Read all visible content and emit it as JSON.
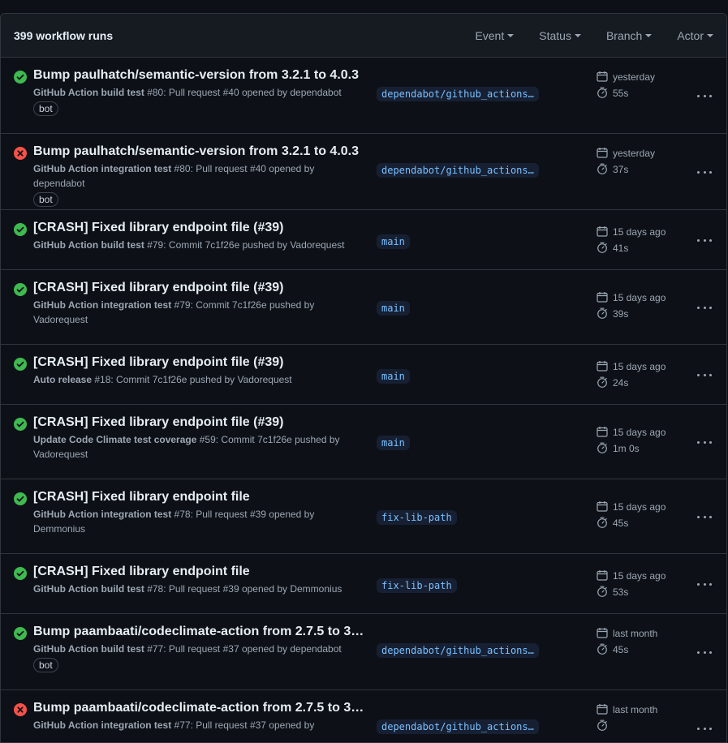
{
  "header": {
    "runs_count": "399 workflow runs",
    "filters": [
      {
        "label": "Event"
      },
      {
        "label": "Status"
      },
      {
        "label": "Branch"
      },
      {
        "label": "Actor"
      }
    ]
  },
  "runs": [
    {
      "status": "success",
      "title": "Bump paulhatch/semantic-version from 3.2.1 to 4.0.3",
      "workflow": "GitHub Action build test",
      "detail": " #80: Pull request #40 opened by dependabot",
      "bot": "bot",
      "branch": "dependabot/github_actions…",
      "when": "yesterday",
      "duration": "55s"
    },
    {
      "status": "failure",
      "title": "Bump paulhatch/semantic-version from 3.2.1 to 4.0.3",
      "workflow": "GitHub Action integration test",
      "detail": " #80: Pull request #40 opened by dependabot",
      "bot": "bot",
      "branch": "dependabot/github_actions…",
      "when": "yesterday",
      "duration": "37s"
    },
    {
      "status": "success",
      "title": "[CRASH] Fixed library endpoint file (#39)",
      "workflow": "GitHub Action build test",
      "detail": " #79: Commit 7c1f26e pushed by Vadorequest",
      "bot": "",
      "branch": "main",
      "when": "15 days ago",
      "duration": "41s"
    },
    {
      "status": "success",
      "title": "[CRASH] Fixed library endpoint file (#39)",
      "workflow": "GitHub Action integration test",
      "detail": " #79: Commit 7c1f26e pushed by Vadorequest",
      "bot": "",
      "branch": "main",
      "when": "15 days ago",
      "duration": "39s"
    },
    {
      "status": "success",
      "title": "[CRASH] Fixed library endpoint file (#39)",
      "workflow": "Auto release",
      "detail": " #18: Commit 7c1f26e pushed by Vadorequest",
      "bot": "",
      "branch": "main",
      "when": "15 days ago",
      "duration": "24s"
    },
    {
      "status": "success",
      "title": "[CRASH] Fixed library endpoint file (#39)",
      "workflow": "Update Code Climate test coverage",
      "detail": " #59: Commit 7c1f26e pushed by Vadorequest",
      "bot": "",
      "branch": "main",
      "when": "15 days ago",
      "duration": "1m 0s"
    },
    {
      "status": "success",
      "title": "[CRASH] Fixed library endpoint file",
      "workflow": "GitHub Action integration test",
      "detail": " #78: Pull request #39 opened by Demmonius",
      "bot": "",
      "branch": "fix-lib-path",
      "when": "15 days ago",
      "duration": "45s"
    },
    {
      "status": "success",
      "title": "[CRASH] Fixed library endpoint file",
      "workflow": "GitHub Action build test",
      "detail": " #78: Pull request #39 opened by Demmonius",
      "bot": "",
      "branch": "fix-lib-path",
      "when": "15 days ago",
      "duration": "53s"
    },
    {
      "status": "success",
      "title": "Bump paambaati/codeclimate-action from 2.7.5 to 3…",
      "workflow": "GitHub Action build test",
      "detail": " #77: Pull request #37 opened by dependabot",
      "bot": "bot",
      "branch": "dependabot/github_actions…",
      "when": "last month",
      "duration": "45s"
    },
    {
      "status": "failure",
      "title": "Bump paambaati/codeclimate-action from 2.7.5 to 3…",
      "workflow": "GitHub Action integration test",
      "detail": " #77: Pull request #37 opened by",
      "bot": "",
      "branch": "dependabot/github_actions…",
      "when": "last month",
      "duration": ""
    }
  ],
  "colors": {
    "success": "#3fb950",
    "failure": "#f85149",
    "accent": "#79c0ff"
  }
}
